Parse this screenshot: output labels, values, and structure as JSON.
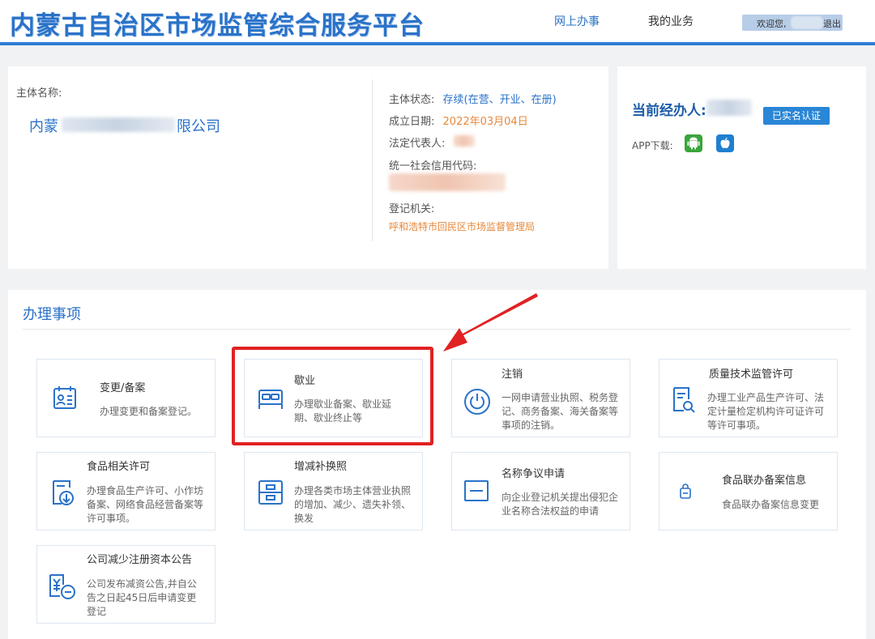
{
  "header": {
    "title": "内蒙古自治区市场监管综合服务平台",
    "nav": [
      {
        "label": "网上办事"
      },
      {
        "label": "我的业务"
      }
    ],
    "user": {
      "welcome": "欢迎您,",
      "logout": "退出"
    }
  },
  "entity": {
    "name_label": "主体名称:",
    "name_prefix": "内蒙",
    "name_suffix": "限公司",
    "status_label": "主体状态:",
    "status_value": "存续(在营、开业、在册)",
    "founded_label": "成立日期:",
    "founded_value": "2022年03月04日",
    "legal_rep_label": "法定代表人:",
    "credit_code_label": "统一社会信用代码:",
    "authority_label": "登记机关:",
    "authority_value": "呼和浩特市回民区市场监督管理局"
  },
  "agent": {
    "title": "当前经办人:",
    "verified": "已实名认证",
    "app_label": "APP下载:"
  },
  "services": {
    "title": "办理事项",
    "cards": [
      {
        "title": "变更/备案",
        "desc": "办理变更和备案登记。",
        "icon": "calendar-icon"
      },
      {
        "title": "歇业",
        "desc": "办理歇业备案、歇业延期、歇业终止等",
        "icon": "bed-icon"
      },
      {
        "title": "注销",
        "desc": "一网申请营业执照、税务登记、商务备案、海关备案等事项的注销。",
        "icon": "power-icon"
      },
      {
        "title": "质量技术监管许可",
        "desc": "办理工业产品生产许可、法定计量检定机构许可证许可等许可事项。",
        "icon": "document-search-icon"
      },
      {
        "title": "食品相关许可",
        "desc": "办理食品生产许可、小作坊备案、网络食品经营备案等许可事项。",
        "icon": "download-document-icon"
      },
      {
        "title": "增减补换照",
        "desc": "办理各类市场主体营业执照的增加、减少、遗失补领、换发",
        "icon": "license-icon"
      },
      {
        "title": "名称争议申请",
        "desc": "向企业登记机关提出侵犯企业名称合法权益的申请",
        "icon": "window-icon"
      },
      {
        "title": "食品联办备案信息",
        "desc": "食品联办备案信息变更",
        "icon": "lock-icon"
      },
      {
        "title": "公司减少注册资本公告",
        "desc": "公司发布减资公告,并自公告之日起45日后申请变更登记",
        "icon": "yuan-minus-icon"
      }
    ]
  },
  "colors": {
    "brand": "#2a72c8",
    "orange": "#e8883a",
    "highlight_red": "#e02222"
  }
}
